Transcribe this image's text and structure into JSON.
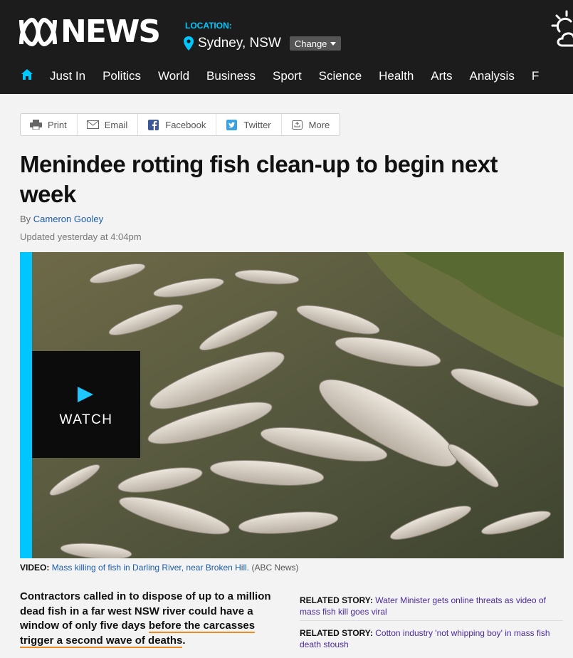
{
  "header": {
    "logo_text": "NEWS",
    "location_label": "LOCATION:",
    "location_city": "Sydney, NSW",
    "change_label": "Change"
  },
  "nav": {
    "items": [
      "Just In",
      "Politics",
      "World",
      "Business",
      "Sport",
      "Science",
      "Health",
      "Arts",
      "Analysis",
      "F"
    ]
  },
  "share": {
    "print": "Print",
    "email": "Email",
    "facebook": "Facebook",
    "twitter": "Twitter",
    "more": "More"
  },
  "article": {
    "headline": "Menindee rotting fish clean-up to begin next week",
    "by_prefix": "By",
    "author": "Cameron Gooley",
    "updated": "Updated yesterday at 4:04pm"
  },
  "media": {
    "watch_label": "WATCH",
    "caption_prefix": "VIDEO:",
    "caption_link": "Mass killing of fish in Darling River, near Broken Hill.",
    "caption_source": "(ABC News)"
  },
  "body": {
    "lead_part1": "Contractors called in to dispose of up to a million dead fish in a far west NSW river could have a window of only five days ",
    "lead_highlight": "before the carcasses trigger a second wave of deaths",
    "lead_end": "."
  },
  "related": [
    {
      "label": "RELATED STORY:",
      "title": "Water Minister gets online threats as video of mass fish kill goes viral"
    },
    {
      "label": "RELATED STORY:",
      "title": "Cotton industry 'not whipping boy' in mass fish death stoush"
    }
  ],
  "colors": {
    "accent": "#00c6ff",
    "header_bg": "#1c1c1c",
    "highlight": "#f08a24",
    "link": "#1a5ca8"
  }
}
